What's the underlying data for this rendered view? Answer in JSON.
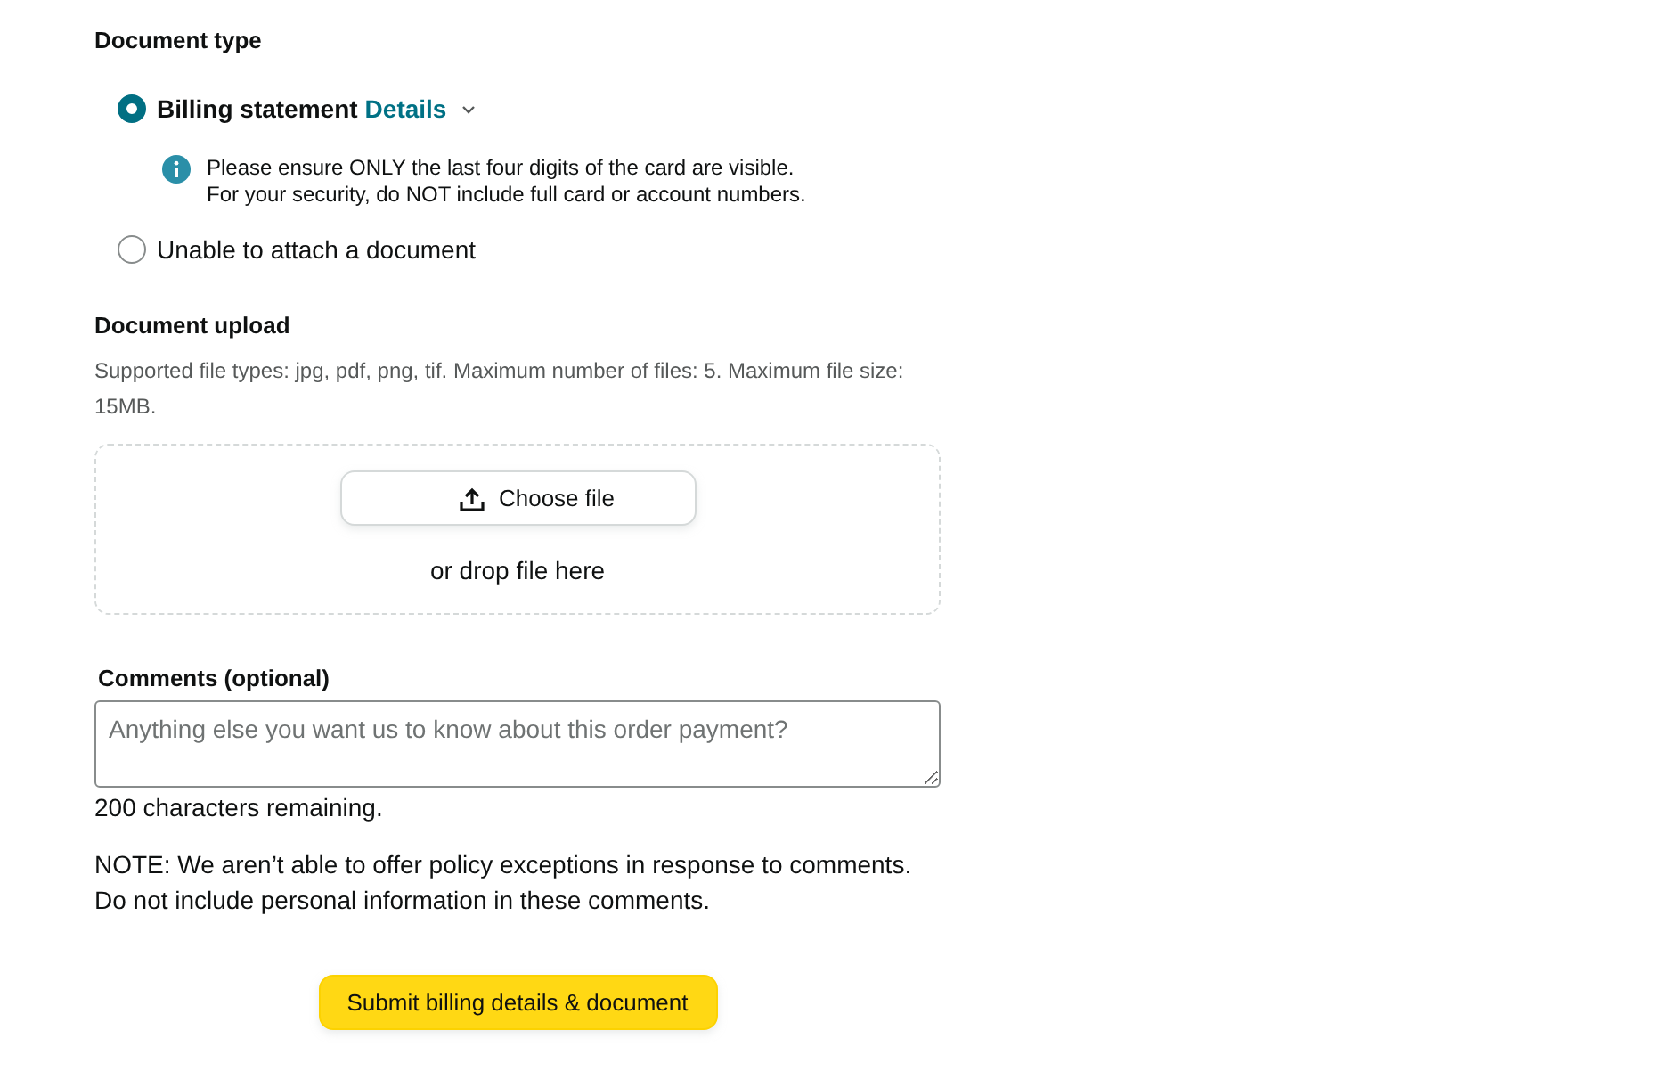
{
  "document_type": {
    "heading": "Document type",
    "options": [
      {
        "label": "Billing statement",
        "link": "Details",
        "selected": true,
        "info": [
          "Please ensure ONLY the last four digits of the card are visible.",
          "For your security, do NOT include full card or account numbers."
        ]
      },
      {
        "label": "Unable to attach a document",
        "selected": false
      }
    ]
  },
  "document_upload": {
    "heading": "Document upload",
    "hint": "Supported file types: jpg, pdf, png, tif. Maximum number of files: 5. Maximum file size: 15MB.",
    "choose_button": "Choose file",
    "drop_text": "or drop file here"
  },
  "comments": {
    "label": "Comments (optional)",
    "placeholder": "Anything else you want us to know about this order payment?",
    "counter": "200 characters remaining.",
    "note": [
      "NOTE: We aren’t able to offer policy exceptions in response to comments.",
      "Do not include personal information in these comments."
    ]
  },
  "submit_button": "Submit billing details & document"
}
